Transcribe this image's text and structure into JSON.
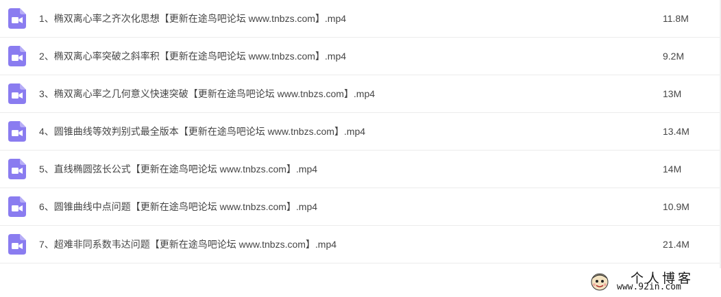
{
  "files": [
    {
      "name": "1、椭双离心率之齐次化思想【更新在途鸟吧论坛 www.tnbzs.com】.mp4",
      "size": "11.8M",
      "icon": "video-file-icon"
    },
    {
      "name": "2、椭双离心率突破之斜率积【更新在途鸟吧论坛 www.tnbzs.com】.mp4",
      "size": "9.2M",
      "icon": "video-file-icon"
    },
    {
      "name": "3、椭双离心率之几何意义快速突破【更新在途鸟吧论坛 www.tnbzs.com】.mp4",
      "size": "13M",
      "icon": "video-file-icon"
    },
    {
      "name": "4、圆锥曲线等效判别式最全版本【更新在途鸟吧论坛 www.tnbzs.com】.mp4",
      "size": "13.4M",
      "icon": "video-file-icon"
    },
    {
      "name": "5、直线椭圆弦长公式【更新在途鸟吧论坛 www.tnbzs.com】.mp4",
      "size": "14M",
      "icon": "video-file-icon"
    },
    {
      "name": "6、圆锥曲线中点问题【更新在途鸟吧论坛 www.tnbzs.com】.mp4",
      "size": "10.9M",
      "icon": "video-file-icon"
    },
    {
      "name": "7、超难非同系数韦达问题【更新在途鸟吧论坛 www.tnbzs.com】.mp4",
      "size": "21.4M",
      "icon": "video-file-icon"
    }
  ],
  "watermark": {
    "title": "个人博客",
    "url": "www.92in.com"
  },
  "colors": {
    "icon": "#8a7cf0",
    "text": "#454545",
    "divider": "#ececec"
  }
}
